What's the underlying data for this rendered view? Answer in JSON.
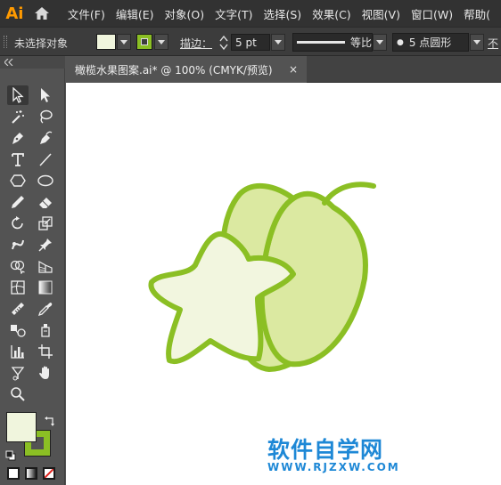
{
  "app": {
    "logo": "Ai"
  },
  "menu": [
    "文件(F)",
    "编辑(E)",
    "对象(O)",
    "文字(T)",
    "选择(S)",
    "效果(C)",
    "视图(V)",
    "窗口(W)",
    "帮助("
  ],
  "control": {
    "selection_label": "未选择对象",
    "stroke_label": "描边：",
    "stroke_value": "5 pt",
    "profile_label": "等比",
    "brush_label": "5 点圆形",
    "opacity_cut": "不"
  },
  "document": {
    "tab_title": "橄榄水果图案.ai* @ 100% (CMYK/预览)",
    "close_symbol": "×"
  },
  "colors": {
    "fill": "#f0f5dd",
    "stroke": "#8bbf24",
    "body_fill": "#dbe9a1",
    "star_fill": "#f2f6df",
    "watermark": "#1e88d6"
  },
  "watermark": {
    "title": "软件自学网",
    "url": "WWW.RJZXW.COM"
  },
  "tools": [
    "selection-tool",
    "direct-selection-tool",
    "magic-wand-tool",
    "lasso-tool",
    "pen-tool",
    "curvature-tool",
    "type-tool",
    "line-tool",
    "polygon-tool",
    "ellipse-tool",
    "pencil-tool",
    "eraser-tool",
    "rotate-tool",
    "scale-tool",
    "puppet-warp-tool",
    "pin-tool",
    "shape-builder-tool",
    "perspective-grid-tool",
    "mesh-tool",
    "gradient-tool",
    "measure-tool",
    "eyedropper-tool",
    "blend-tool",
    "live-paint-tool",
    "column-graph-tool",
    "artboard-tool",
    "slice-tool",
    "hand-tool",
    "zoom-tool"
  ]
}
